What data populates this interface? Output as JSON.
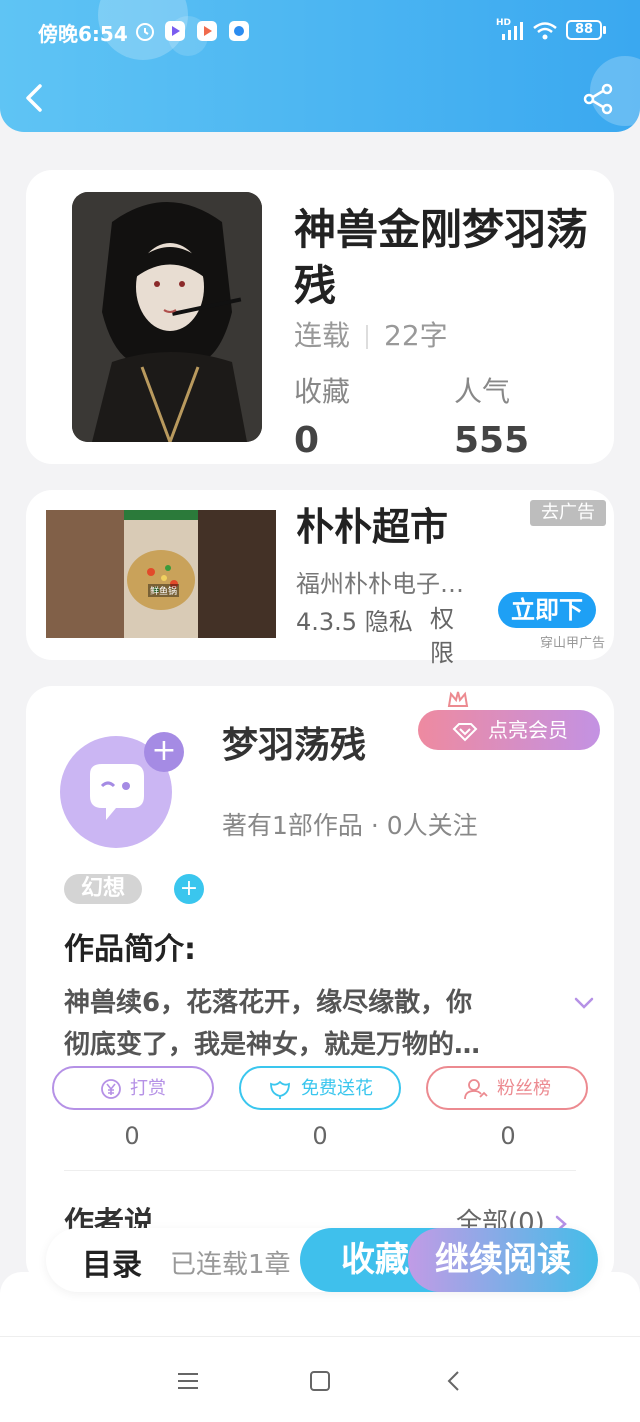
{
  "status_bar": {
    "time": "傍晚6:54",
    "network": "HD",
    "battery": "88"
  },
  "header": {
    "back_icon": "chevron-left-icon",
    "share_icon": "share-icon",
    "colors": {
      "start": "#5fc4f4",
      "end": "#3aa8f0"
    }
  },
  "book": {
    "title": "神兽金刚梦羽荡残",
    "status": "连载",
    "word_count": "22字",
    "favorites_label": "收藏",
    "favorites_value": "0",
    "popularity_label": "人气",
    "popularity_value": "555"
  },
  "ad": {
    "title": "朴朴超市",
    "tag": "去广告",
    "company": "福州朴朴电子…",
    "version": "4.3.5 隐私",
    "permission": "权限",
    "button": "立即下",
    "source": "穿山甲广告",
    "image_badge": "鲜鱼锅"
  },
  "author": {
    "name": "梦羽荡残",
    "vip_button": "点亮会员",
    "stats": "著有1部作品 · 0人关注",
    "genre_tag": "幻想",
    "intro_heading": "作品简介:",
    "intro_line1": "神兽续6，花落花开，缘尽缘散，你",
    "intro_line2": "彻底变了，我是神女，就是万物的…",
    "actions": [
      {
        "label": "打赏",
        "count": "0",
        "icon": "yen-icon",
        "color": "#b591e6"
      },
      {
        "label": "免费送花",
        "count": "0",
        "icon": "flower-icon",
        "color": "#3ac6ee"
      },
      {
        "label": "粉丝榜",
        "count": "0",
        "icon": "user-rank-icon",
        "color": "#ec8a90"
      }
    ],
    "author_says_label": "作者说",
    "all_link": "全部(0)"
  },
  "bottom_bar": {
    "catalog": "目录",
    "status": "已连载1章",
    "collect": "收藏",
    "continue_read": "继续阅读"
  }
}
